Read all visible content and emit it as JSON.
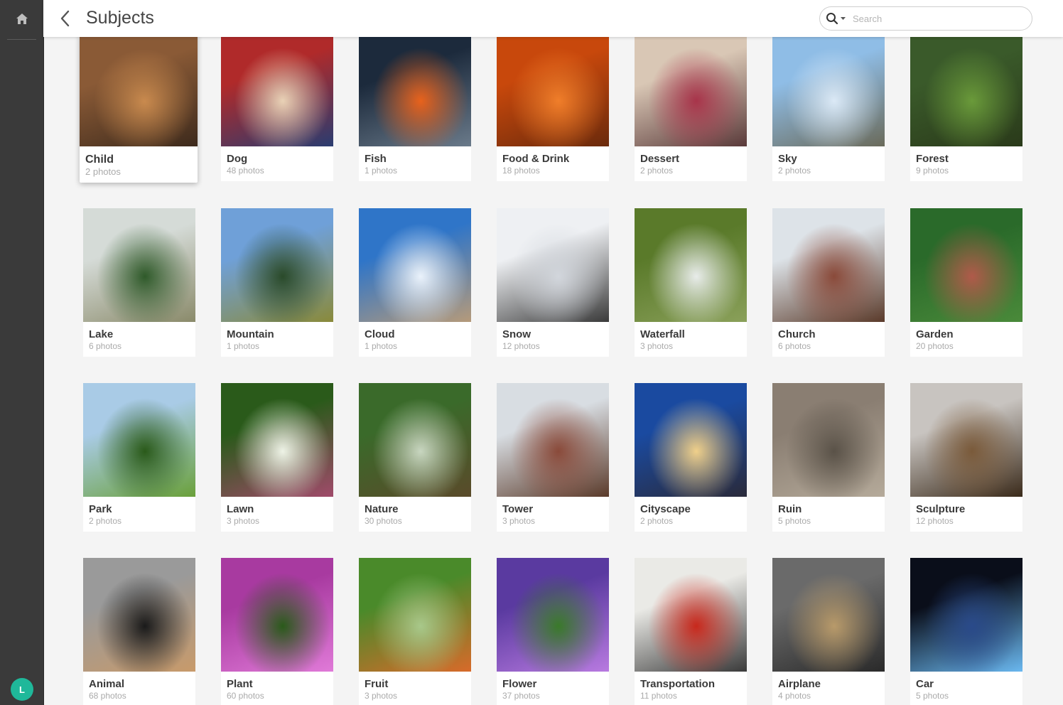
{
  "page": {
    "title": "Subjects"
  },
  "search": {
    "placeholder": "Search",
    "value": ""
  },
  "user": {
    "initial": "L"
  },
  "icons": {
    "home": "home-icon",
    "back": "chevron-left-icon",
    "search": "search-icon",
    "dropdown": "caret-down-icon"
  },
  "colors": {
    "sidebar": "#3a3a3a",
    "avatar": "#1fb89a"
  },
  "subjects": [
    {
      "name": "Child",
      "count": "2 photos",
      "colors": [
        "#8a5a36",
        "#c98a4e",
        "#3d2a1c"
      ]
    },
    {
      "name": "Dog",
      "count": "48 photos",
      "colors": [
        "#b02a2a",
        "#e9d2b6",
        "#2a3c70"
      ]
    },
    {
      "name": "Fish",
      "count": "1 photos",
      "colors": [
        "#1c2a3c",
        "#e8621c",
        "#6a7a8a"
      ]
    },
    {
      "name": "Food & Drink",
      "count": "18 photos",
      "colors": [
        "#c8480c",
        "#f07e2a",
        "#6a2a0c"
      ]
    },
    {
      "name": "Dessert",
      "count": "2 photos",
      "colors": [
        "#d9c7b5",
        "#a8344a",
        "#5a3a3a"
      ]
    },
    {
      "name": "Sky",
      "count": "2 photos",
      "colors": [
        "#8fbde6",
        "#dbe9f6",
        "#6a6a5a"
      ]
    },
    {
      "name": "Forest",
      "count": "9 photos",
      "colors": [
        "#3a5a2a",
        "#6a9a3a",
        "#2a3a1a"
      ]
    },
    {
      "name": "Lake",
      "count": "6 photos",
      "colors": [
        "#d5dbd7",
        "#2f5a2a",
        "#8a8a6a"
      ]
    },
    {
      "name": "Mountain",
      "count": "1 photos",
      "colors": [
        "#6fa0d8",
        "#2a4a2a",
        "#8a8a3a"
      ]
    },
    {
      "name": "Cloud",
      "count": "1 photos",
      "colors": [
        "#2f75c8",
        "#eaf2fb",
        "#b59a7a"
      ]
    },
    {
      "name": "Snow",
      "count": "12 photos",
      "colors": [
        "#eef0f3",
        "#d2d6dc",
        "#3a3a3a"
      ]
    },
    {
      "name": "Waterfall",
      "count": "3 photos",
      "colors": [
        "#5a7a2a",
        "#e8ecea",
        "#8aa05a"
      ]
    },
    {
      "name": "Church",
      "count": "6 photos",
      "colors": [
        "#dde3e8",
        "#8a4a3a",
        "#5a3a2a"
      ]
    },
    {
      "name": "Garden",
      "count": "20 photos",
      "colors": [
        "#2a6a2a",
        "#b05a4a",
        "#4a8a3a"
      ]
    },
    {
      "name": "Park",
      "count": "2 photos",
      "colors": [
        "#a9cbe6",
        "#2a5a1a",
        "#6aa03a"
      ]
    },
    {
      "name": "Lawn",
      "count": "3 photos",
      "colors": [
        "#2a5a1a",
        "#eef3e6",
        "#a04a6a"
      ]
    },
    {
      "name": "Nature",
      "count": "30 photos",
      "colors": [
        "#3a6a2a",
        "#c8d6c0",
        "#5a4a2a"
      ]
    },
    {
      "name": "Tower",
      "count": "3 photos",
      "colors": [
        "#d8dde2",
        "#8a4a3a",
        "#5a3a2a"
      ]
    },
    {
      "name": "Cityscape",
      "count": "2 photos",
      "colors": [
        "#1a4aa0",
        "#f0d08a",
        "#2a2a3a"
      ]
    },
    {
      "name": "Ruin",
      "count": "5 photos",
      "colors": [
        "#8a7e72",
        "#5a5248",
        "#b5aa9a"
      ]
    },
    {
      "name": "Sculpture",
      "count": "12 photos",
      "colors": [
        "#c8c4c0",
        "#7a5a3a",
        "#3a2a1a"
      ]
    },
    {
      "name": "Animal",
      "count": "68 photos",
      "colors": [
        "#9a9a9a",
        "#1a1a1a",
        "#c89a6a"
      ]
    },
    {
      "name": "Plant",
      "count": "60 photos",
      "colors": [
        "#a83aa0",
        "#2a5a1a",
        "#e07ad8"
      ]
    },
    {
      "name": "Fruit",
      "count": "3 photos",
      "colors": [
        "#4a8a2a",
        "#a8c88a",
        "#d86a2a"
      ]
    },
    {
      "name": "Flower",
      "count": "37 photos",
      "colors": [
        "#5a3aa0",
        "#3a7a2a",
        "#b87ae0"
      ]
    },
    {
      "name": "Transportation",
      "count": "11 photos",
      "colors": [
        "#eaeae6",
        "#c8281c",
        "#3a3a3a"
      ]
    },
    {
      "name": "Airplane",
      "count": "4 photos",
      "colors": [
        "#6a6a6a",
        "#b89a6a",
        "#2a2a2a"
      ]
    },
    {
      "name": "Car",
      "count": "5 photos",
      "colors": [
        "#0a0e1a",
        "#2a4a8a",
        "#6ab8f0"
      ]
    }
  ]
}
